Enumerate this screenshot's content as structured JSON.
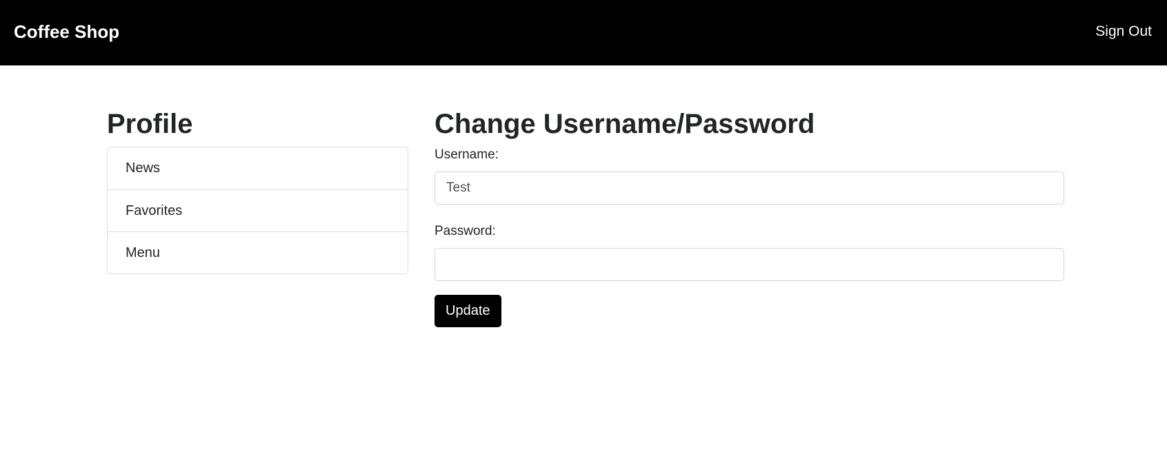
{
  "navbar": {
    "brand": "Coffee Shop",
    "sign_out": "Sign Out"
  },
  "sidebar": {
    "title": "Profile",
    "items": [
      {
        "label": "News"
      },
      {
        "label": "Favorites"
      },
      {
        "label": "Menu"
      }
    ]
  },
  "form": {
    "title": "Change Username/Password",
    "username_label": "Username:",
    "username_value": "Test",
    "password_label": "Password:",
    "password_value": "",
    "submit_label": "Update"
  },
  "colors": {
    "navbar_bg": "#000000",
    "button_bg": "#000000",
    "text": "#212529"
  }
}
